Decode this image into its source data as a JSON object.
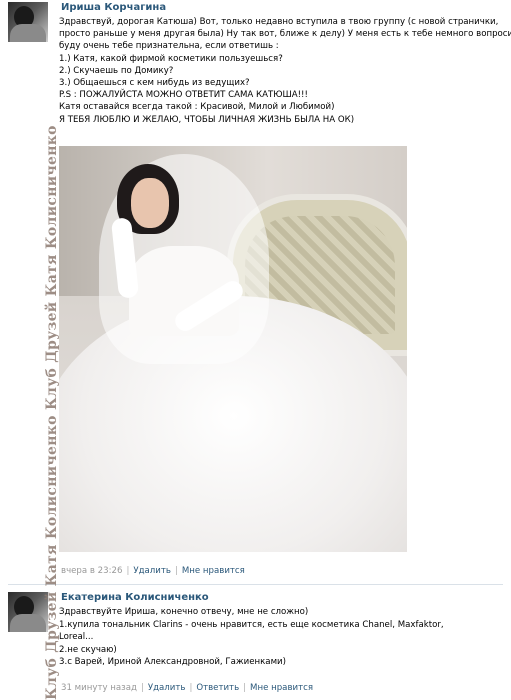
{
  "posts": [
    {
      "author": "Ириша Корчагина",
      "avatar_icon": "user-avatar",
      "lines": [
        "Здравствуй, дорогая Катюша) Вот, только недавно вступила в твою группу (с новой странички,",
        "просто раньше у меня другая была) Ну так вот, ближе к делу) У меня есть к тебе немного вопросиков,",
        "буду очень тебе признательна, если ответишь :",
        "1.) Катя, какой фирмой косметики пользуешься?",
        "2.) Скучаешь по Домику?",
        "3.) Общаешься с кем нибудь из ведущих?",
        "P.S : ПОЖАЛУЙСТА МОЖНО ОТВЕТИТ САМА КАТЮША!!!",
        "Катя оставайся всегда такой : Красивой, Милой и Любимой)",
        "Я ТЕБЯ ЛЮБЛЮ И ЖЕЛАЮ, ЧТОБЫ ЛИЧНАЯ ЖИЗНЬ БЫЛА НА ОК)"
      ],
      "time": "вчера в 23:26",
      "actions": [
        "Удалить",
        "Мне нравится"
      ]
    },
    {
      "author": "Екатерина Колисниченко",
      "avatar_icon": "user-avatar",
      "lines": [
        "Здравствуйте Ириша, конечно отвечу, мне не сложно)",
        "1.купила тональник Clarins - очень нравится, есть еще косметика Chanel, Maxfaktor,",
        "Loreal...",
        "2.не скучаю)",
        "3.с Варей, Ириной Александровной, Гажиенками)"
      ],
      "time": "31 минуту назад",
      "actions": [
        "Удалить",
        "Ответить",
        "Мне нравится"
      ]
    }
  ],
  "watermark": "Клуб Друзей Катя Колисниченко Клуб Друзей Катя Колисниченко",
  "colors": {
    "link": "#2b587a",
    "meta": "#999999",
    "divider": "#dae1e8"
  }
}
